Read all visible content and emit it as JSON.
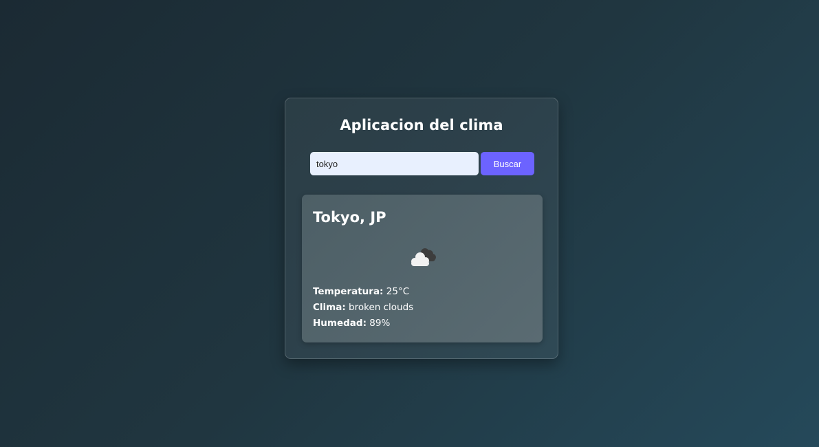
{
  "app": {
    "title": "Aplicacion del clima"
  },
  "search": {
    "value": "tokyo",
    "button_label": "Buscar"
  },
  "weather": {
    "city": "Tokyo, JP",
    "icon": "broken-clouds-icon",
    "temperature_label": "Temperatura:",
    "temperature_value": "25°C",
    "condition_label": "Clima:",
    "condition_value": "broken clouds",
    "humidity_label": "Humedad:",
    "humidity_value": "89%"
  },
  "colors": {
    "accent": "#6c63ff",
    "input_bg": "#e8f0fe"
  }
}
